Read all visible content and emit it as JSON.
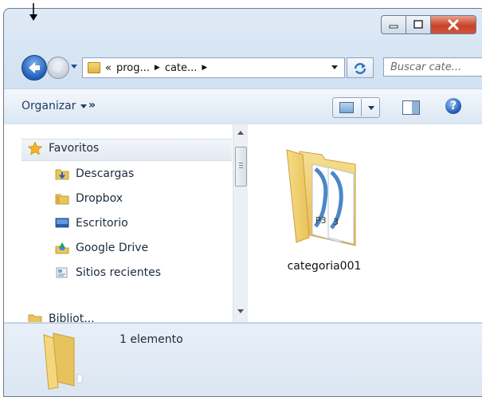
{
  "window": {
    "caption_buttons": [
      "minimize",
      "maximize",
      "close"
    ]
  },
  "address": {
    "crumbs": [
      "«",
      "prog...",
      "cate..."
    ],
    "search_placeholder": "Buscar cate..."
  },
  "toolbar": {
    "organize_label": "Organizar",
    "more_label": "»"
  },
  "nav": {
    "items": [
      {
        "label": "Favoritos",
        "icon": "star-icon"
      },
      {
        "label": "Descargas",
        "icon": "downloads-folder-icon"
      },
      {
        "label": "Dropbox",
        "icon": "dropbox-folder-icon"
      },
      {
        "label": "Escritorio",
        "icon": "desktop-icon"
      },
      {
        "label": "Google Drive",
        "icon": "google-drive-icon"
      },
      {
        "label": "Sitios recientes",
        "icon": "recent-places-icon"
      },
      {
        "label": "Bibliot...",
        "icon": "libraries-icon"
      }
    ]
  },
  "files": {
    "items": [
      {
        "name": "categoria001",
        "icon": "folder-mp3-icon"
      }
    ]
  },
  "details": {
    "count_text": "1 elemento"
  },
  "colors": {
    "close_button": "#c8412a",
    "chrome": "#cfdff0",
    "details_bar": "#dbe6f2"
  }
}
